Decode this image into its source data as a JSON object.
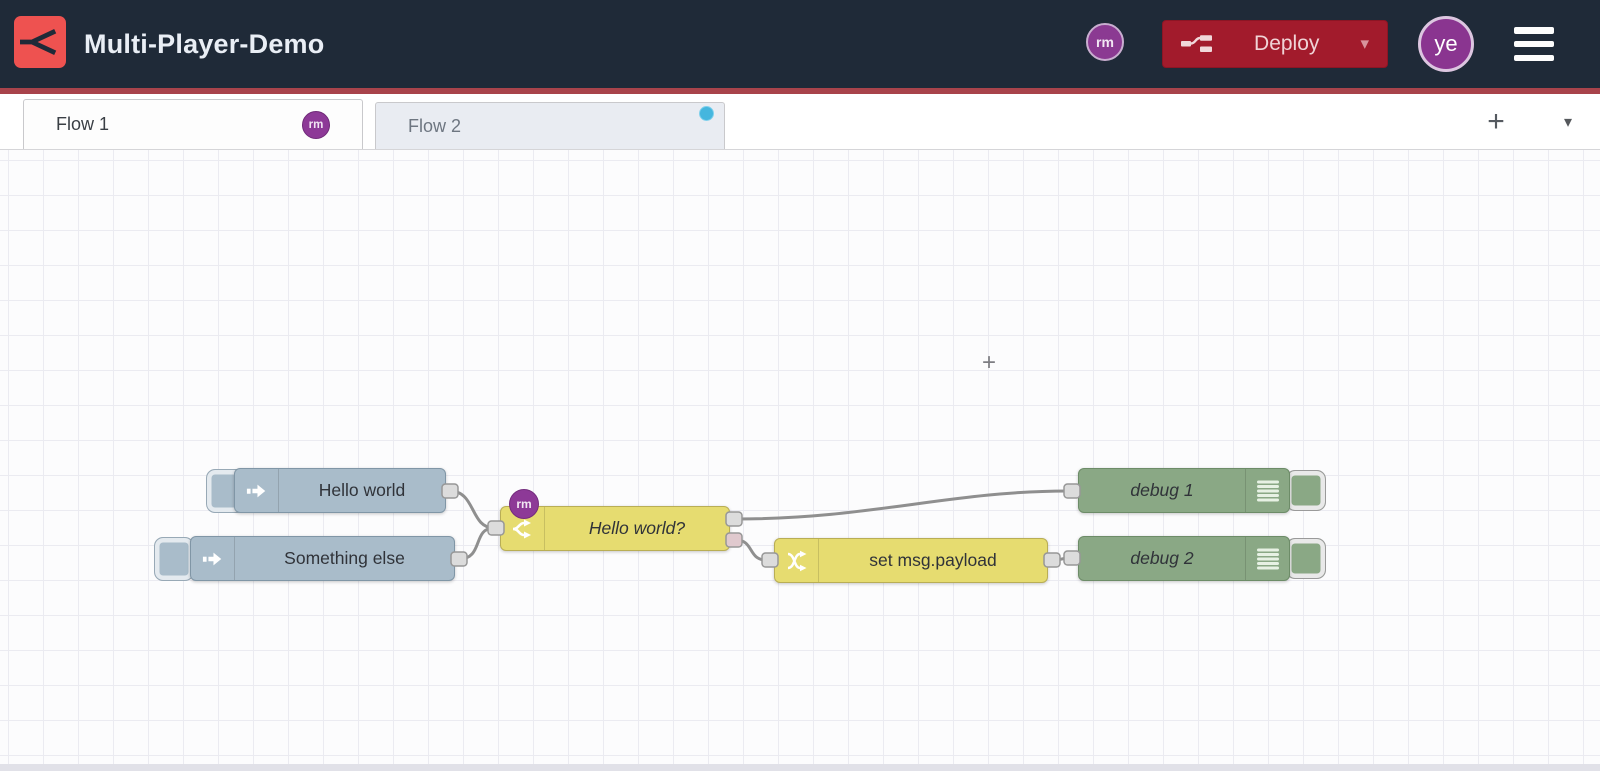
{
  "header": {
    "title": "Multi-Player-Demo",
    "small_badge": "rm",
    "deploy": {
      "label": "Deploy",
      "caret": "▾"
    },
    "avatar": "ye"
  },
  "tabbar": {
    "tabs": [
      {
        "label": "Flow 1",
        "badge": "rm",
        "active": true
      },
      {
        "label": "Flow 2",
        "active": false,
        "has_changes_dot": true
      }
    ],
    "add_label": "+",
    "list_caret": "▾"
  },
  "flow": {
    "nodes": {
      "inject1": {
        "type": "inject",
        "label": "Hello world"
      },
      "inject2": {
        "type": "inject",
        "label": "Something else"
      },
      "switch1": {
        "type": "switch",
        "label": "Hello world?",
        "badge": "rm"
      },
      "change1": {
        "type": "change",
        "label": "set msg.payload"
      },
      "debug1": {
        "type": "debug",
        "label": "debug 1"
      },
      "debug2": {
        "type": "debug",
        "label": "debug 2"
      }
    },
    "cursor_plus": "+"
  },
  "colors": {
    "header_bg": "#1f2a38",
    "brand_red": "#ee5250",
    "deploy_red": "#a21b2c",
    "underline_red": "#a8434b",
    "collab_purple": "#8d3997",
    "tab_changes_blue": "#45b6de",
    "inject_fill": "#a9bcca",
    "function_fill": "#e6dc70",
    "debug_fill": "#8aa885",
    "wire_gray": "#8f8f8f"
  }
}
